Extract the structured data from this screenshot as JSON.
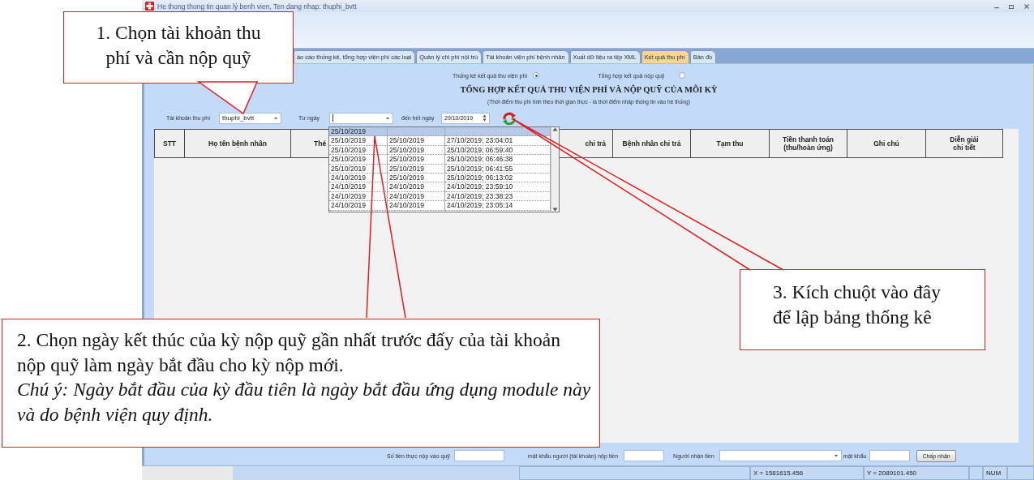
{
  "window": {
    "title": "He thong thong tin quan lý benh vien, Ten dang nhap: thuphi_bvtt"
  },
  "tabs": [
    {
      "label": "áo cáo thống kê, tổng hợp viện phí các loại",
      "selected": false
    },
    {
      "label": "Quản lý chi phí nội trú",
      "selected": false
    },
    {
      "label": "Tài khoản viện phí bệnh nhân",
      "selected": false
    },
    {
      "label": "Xuất dữ liệu ra tệp XML",
      "selected": false
    },
    {
      "label": "Kết quả thu phí",
      "selected": true
    },
    {
      "label": "Bản đồ",
      "selected": false
    }
  ],
  "report_mode": [
    {
      "label": "Thống kê kết quả thu viện phí",
      "selected": true
    },
    {
      "label": "Tổng hợp kết quả nộp quỹ",
      "selected": false
    }
  ],
  "report": {
    "title": "TỔNG HỢP KẾT QUẢ THU VIỆN PHÍ VÀ NỘP QUỸ CỦA MỖI KỲ",
    "subtitle": "(Thời điểm thu phí tính theo thời gian thực - là thời điểm nhập thông tin vào hệ thống)"
  },
  "filters": {
    "account_label": "Tài khoản thu phí",
    "account_value": "thuphi_bvtt",
    "from_label": "Từ ngày",
    "to_label": "đến hết ngày",
    "to_value": "29/10/2019"
  },
  "table": {
    "columns": [
      "STT",
      "Họ tên bệnh nhân",
      "Thẻ",
      "chi trả",
      "Bệnh nhân chi trả",
      "Tạm thu",
      "Tiền thanh toán (thu/hoàn ứng)",
      "Ghi chú",
      "Diễn giải chi tiết"
    ]
  },
  "date_dropdown": {
    "rows": [
      {
        "column_1": "25/10/2019",
        "selected": true
      },
      {
        "column_1": "25/10/2019",
        "column_2": "25/10/2019",
        "column_3": "27/10/2019; 23:04:01",
        "selected": false
      },
      {
        "column_1": "25/10/2019",
        "column_2": "25/10/2019",
        "column_3": "25/10/2019; 06:59:40",
        "selected": false
      },
      {
        "column_1": "25/10/2019",
        "column_2": "25/10/2019",
        "column_3": "25/10/2019; 06:46:38",
        "selected": false
      },
      {
        "column_1": "25/10/2019",
        "column_2": "25/10/2019",
        "column_3": "25/10/2019; 06:41:55",
        "selected": false
      },
      {
        "column_1": "24/10/2019",
        "column_2": "25/10/2019",
        "column_3": "25/10/2019; 06:13:02",
        "selected": false
      },
      {
        "column_1": "24/10/2019",
        "column_2": "24/10/2019",
        "column_3": "24/10/2019; 23:59:10",
        "selected": false
      },
      {
        "column_1": "24/10/2019",
        "column_2": "24/10/2019",
        "column_3": "24/10/2019; 23:38:23",
        "selected": false
      },
      {
        "column_1": "24/10/2019",
        "column_2": "24/10/2019",
        "column_3": "24/10/2019; 23:05:14",
        "selected": false
      }
    ]
  },
  "footer": {
    "amount_label": "Số tiền thực nộp vào quỹ",
    "payer_password_label": "mật khẩu người (tài khoản) nộp tiền",
    "receiver_label": "Người nhận tiền",
    "password_label": "mật khẩu",
    "accept_button": "Chấp nhận"
  },
  "status_bar": {
    "x": "X = 1581615.456",
    "y": "Y = 2089101.450",
    "num": "NUM"
  },
  "callouts": [
    {
      "text": "1. Chọn tài khoản thu phí và cần nộp quỹ"
    },
    {
      "text": "2. Chọn ngày kết thúc của kỳ nộp quỹ gần nhất trước đấy của tài khoản nộp quỹ làm ngày bắt đầu cho kỳ nộp mới.",
      "note": "Chú ý: Ngày bắt đầu của kỳ đầu tiên là ngày bắt đầu ứng dụng module này và do bệnh viện quy định."
    },
    {
      "text": "3. Kích chuột vào đây để lập bảng thống kê"
    }
  ]
}
